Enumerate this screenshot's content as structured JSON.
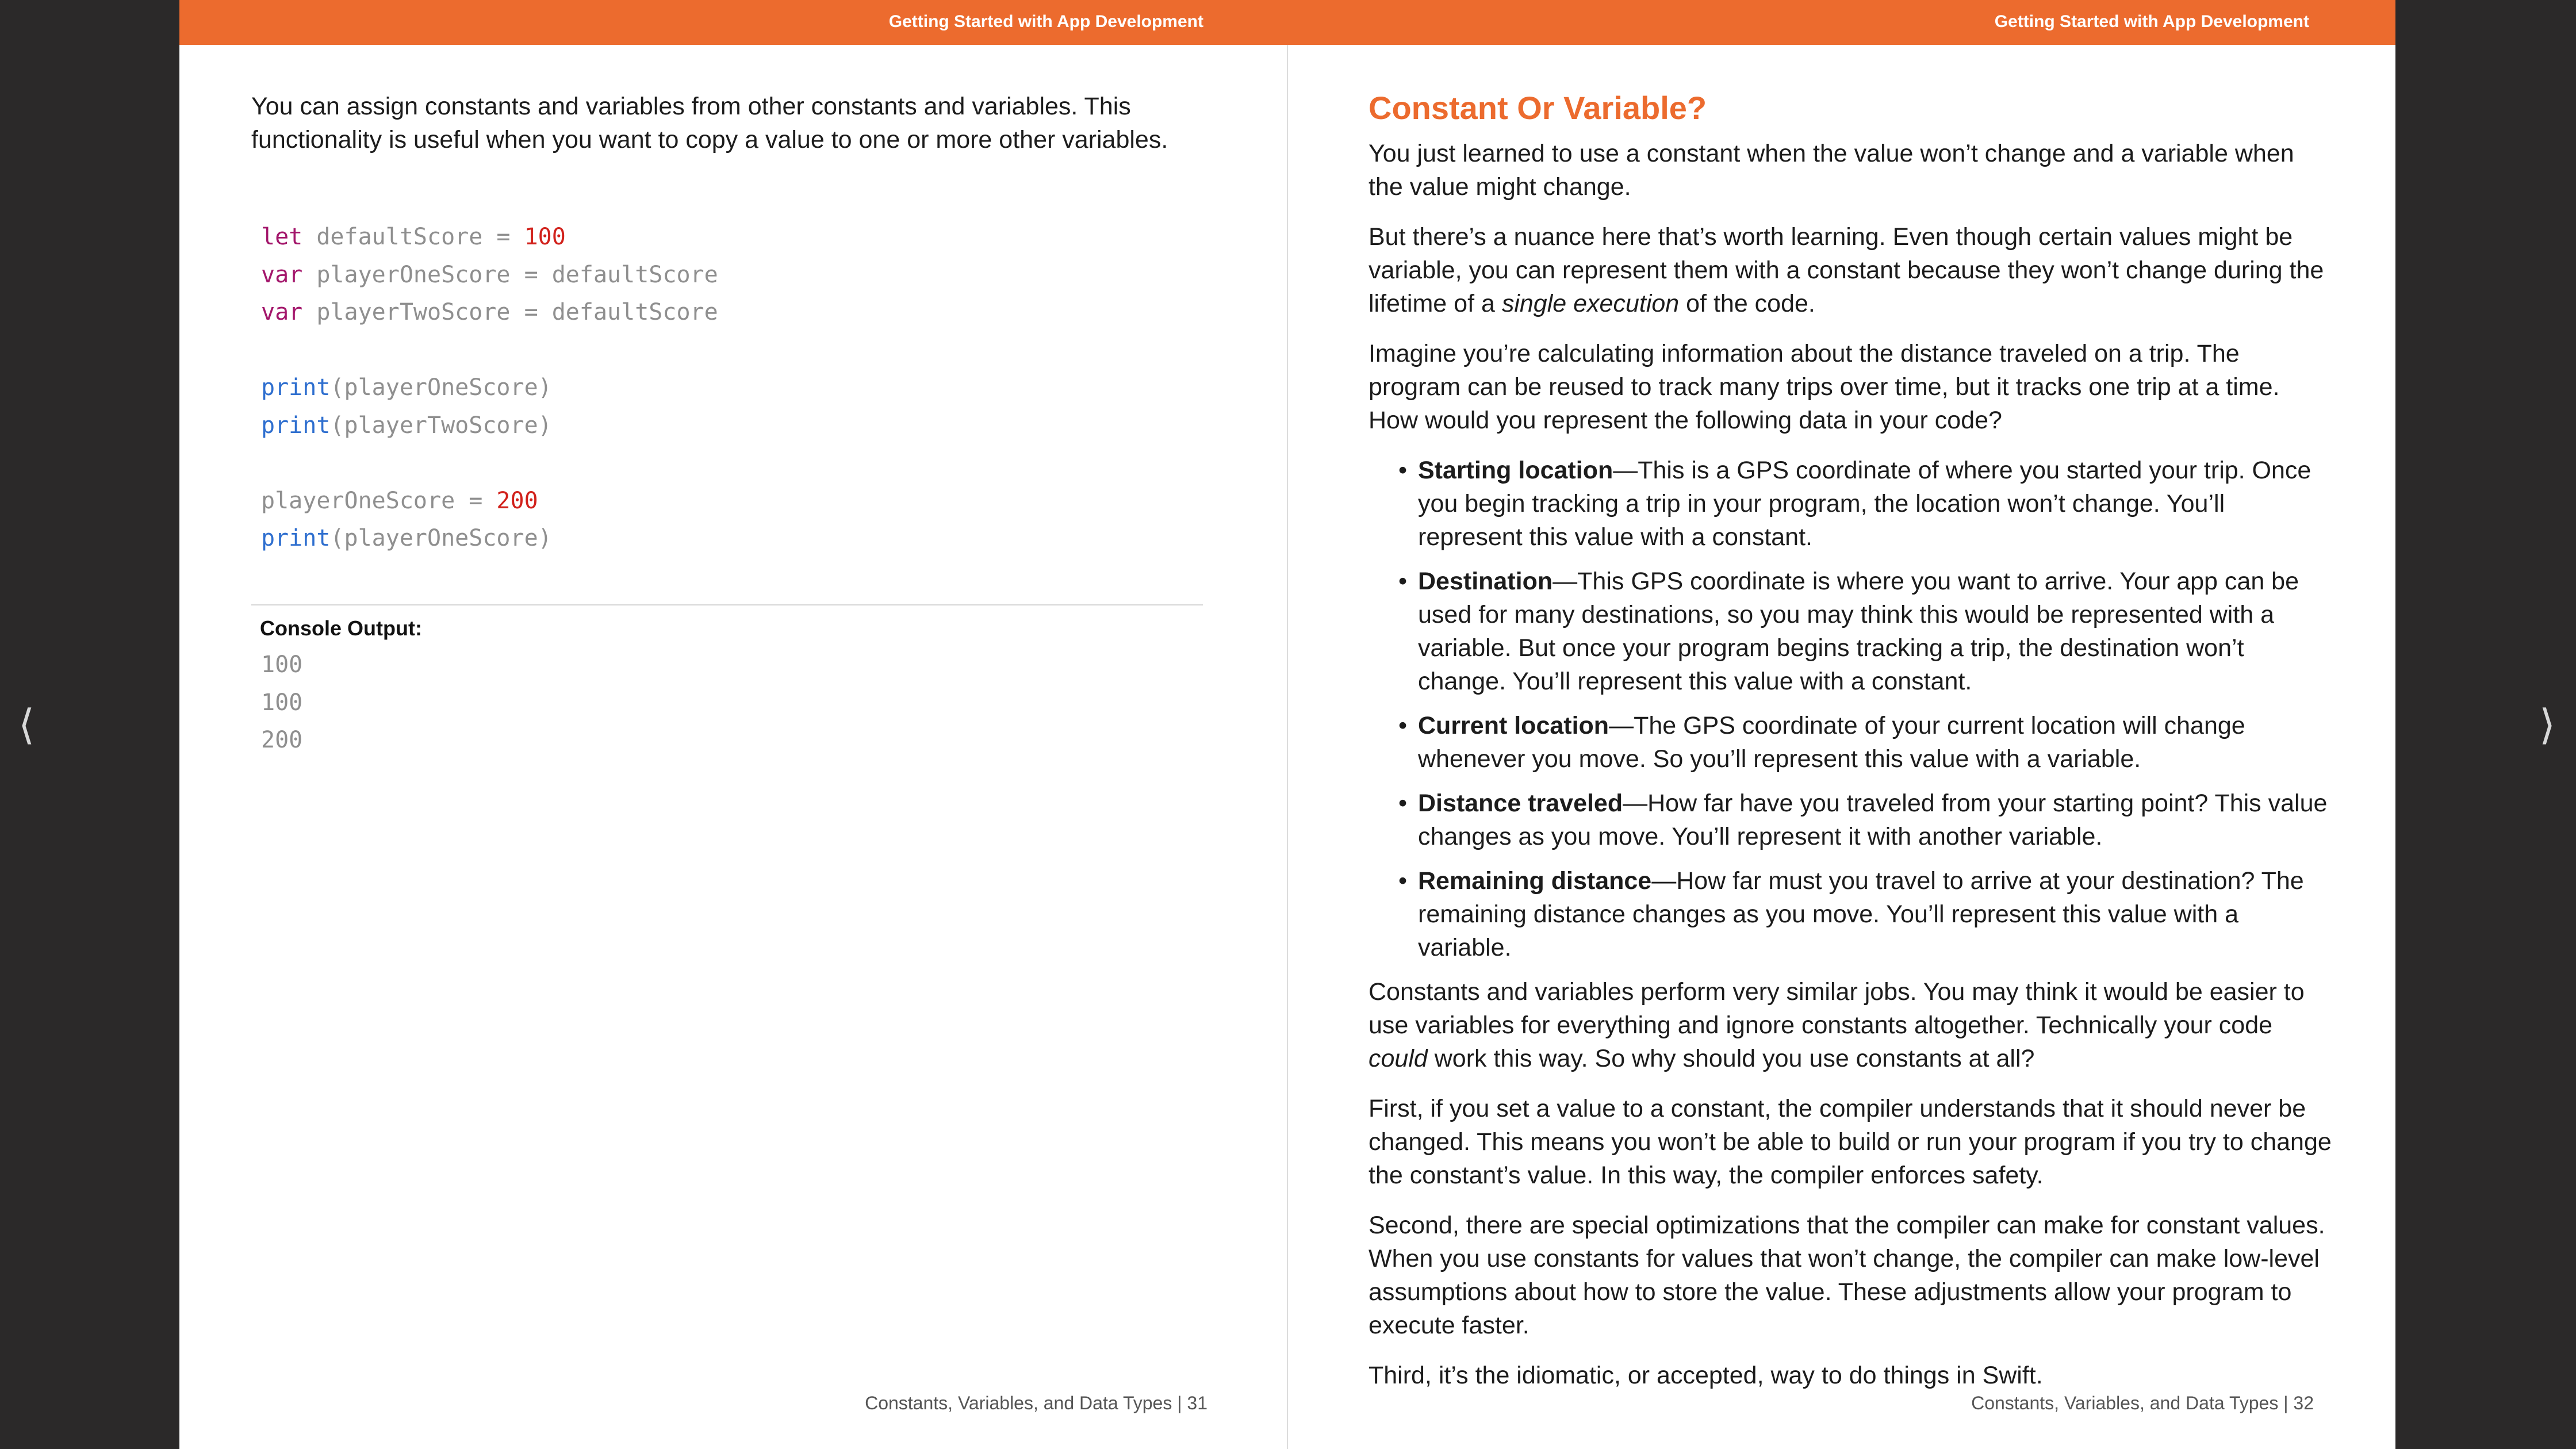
{
  "header": {
    "left_title": "Getting Started with App Development",
    "right_title": "Getting Started with App Development"
  },
  "nav": {
    "prev_icon": "chevron-left-icon",
    "next_icon": "chevron-right-icon",
    "prev_glyph": "⟨",
    "next_glyph": "⟩"
  },
  "left_page": {
    "intro": "You can assign constants and variables from other constants and variables. This functionality is useful when you want to copy a value to one or more other variables.",
    "code_lines": [
      [
        {
          "t": "let",
          "c": "kw"
        },
        {
          "t": " defaultScore = ",
          "c": ""
        },
        {
          "t": "100",
          "c": "num"
        }
      ],
      [
        {
          "t": "var",
          "c": "kw"
        },
        {
          "t": " playerOneScore = defaultScore",
          "c": ""
        }
      ],
      [
        {
          "t": "var",
          "c": "kw"
        },
        {
          "t": " playerTwoScore = defaultScore",
          "c": ""
        }
      ],
      [],
      [
        {
          "t": "print",
          "c": "fn"
        },
        {
          "t": "(playerOneScore)",
          "c": ""
        }
      ],
      [
        {
          "t": "print",
          "c": "fn"
        },
        {
          "t": "(playerTwoScore)",
          "c": ""
        }
      ],
      [],
      [
        {
          "t": "playerOneScore = ",
          "c": ""
        },
        {
          "t": "200",
          "c": "num"
        }
      ],
      [
        {
          "t": "print",
          "c": "fn"
        },
        {
          "t": "(playerOneScore)",
          "c": ""
        }
      ]
    ],
    "console_label": "Console Output:",
    "console_lines": [
      "100",
      "100",
      "200"
    ],
    "footer": "Constants, Variables, and Data Types  |  31"
  },
  "right_page": {
    "title": "Constant Or Variable?",
    "para1": "You just learned to use a constant when the value won’t change and a variable when the value might change.",
    "para2_a": "But there’s a nuance here that’s worth learning. Even though certain values might be variable, you can represent them with a constant because they won’t change during the lifetime of a ",
    "para2_em": "single execution",
    "para2_b": " of the code.",
    "para3": "Imagine you’re calculating information about the distance traveled on a trip. The program can be reused to track many trips over time, but it tracks one trip at a time. How would you represent the following data in your code?",
    "bullets": [
      {
        "term": "Starting location",
        "text": "—This is a GPS coordinate of where you started your trip. Once you begin tracking a trip in your program, the location won’t change. You’ll represent this value with a constant."
      },
      {
        "term": "Destination",
        "text": "—This GPS coordinate is where you want to arrive. Your app can be used for many destinations, so you may think this would be represented with a variable. But once your program begins tracking a trip, the destination won’t change. You’ll represent this value with a constant."
      },
      {
        "term": "Current location",
        "text": "—The GPS coordinate of your current location will change whenever you move. So you’ll represent this value with a variable."
      },
      {
        "term": "Distance traveled",
        "text": "—How far have you traveled from your starting point? This value changes as you move. You’ll represent it with another variable."
      },
      {
        "term": "Remaining distance",
        "text": "—How far must you travel to arrive at your destination? The remaining distance changes as you move. You’ll represent this value with a variable."
      }
    ],
    "bullet_glyph": "•",
    "para4_a": "Constants and variables perform very similar jobs. You may think it would be easier to use variables for everything and ignore constants altogether. Technically your code ",
    "para4_em": "could",
    "para4_b": " work this way. So why should you use constants at all?",
    "para5": "First, if you set a value to a constant, the compiler understands that it should never be changed. This means you won’t be able to build or run your program if you try to change the constant’s value. In this way, the compiler enforces safety.",
    "para6": "Second, there are special optimizations that the compiler can make for constant values. When you use constants for values that won’t change, the compiler can make low-level assumptions about how to store the value. These adjustments allow your program to execute faster.",
    "para7": "Third, it’s the idiomatic, or accepted, way to do things in Swift.",
    "footer": "Constants, Variables, and Data Types  |  32"
  },
  "colors": {
    "accent": "#ec6b2e",
    "background": "#2b2929",
    "keyword": "#a3166b",
    "function": "#2f6fcf",
    "number": "#d1211b"
  }
}
